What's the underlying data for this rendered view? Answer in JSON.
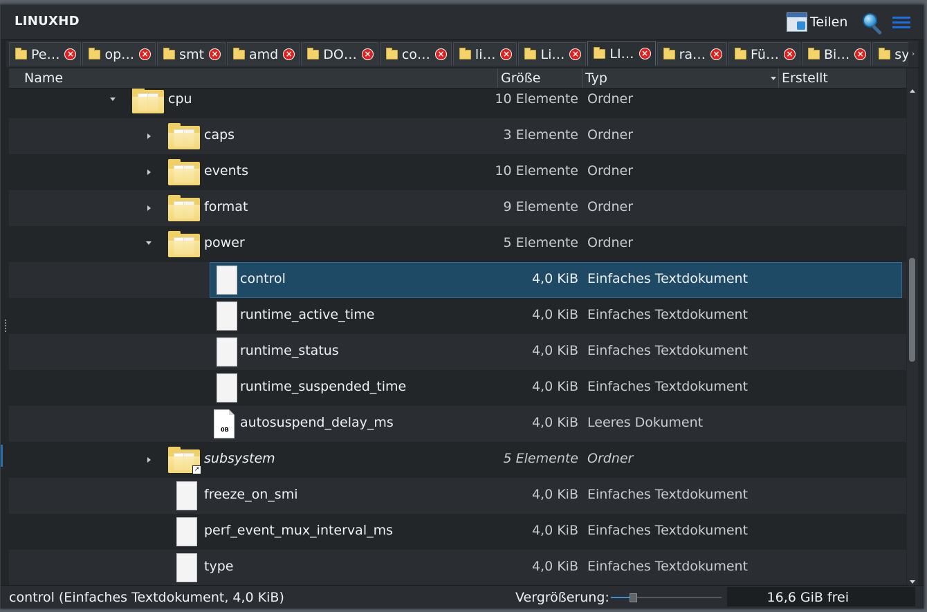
{
  "window": {
    "title": "LINUXHD"
  },
  "toolbar": {
    "share_label": "Teilen"
  },
  "tabs": [
    {
      "label": "Pe…",
      "active": false
    },
    {
      "label": "op…",
      "active": false
    },
    {
      "label": "smt",
      "active": false
    },
    {
      "label": "amd",
      "active": false
    },
    {
      "label": "DO…",
      "active": false
    },
    {
      "label": "co…",
      "active": false
    },
    {
      "label": "li…",
      "active": false
    },
    {
      "label": "Li…",
      "active": false
    },
    {
      "label": "LI…",
      "active": true
    },
    {
      "label": "ra…",
      "active": false
    },
    {
      "label": "Fü…",
      "active": false
    },
    {
      "label": "Bi…",
      "active": false
    },
    {
      "label": "sy",
      "active": false
    }
  ],
  "columns": {
    "name": "Name",
    "size": "Größe",
    "type": "Typ",
    "created": "Erstellt"
  },
  "rows": [
    {
      "name": "cpu",
      "size": "10 Elemente",
      "type": "Ordner",
      "kind": "folder",
      "level": 0,
      "expander": "down"
    },
    {
      "name": "caps",
      "size": "3 Elemente",
      "type": "Ordner",
      "kind": "folder",
      "level": 1,
      "expander": "right"
    },
    {
      "name": "events",
      "size": "10 Elemente",
      "type": "Ordner",
      "kind": "folder",
      "level": 1,
      "expander": "right"
    },
    {
      "name": "format",
      "size": "9 Elemente",
      "type": "Ordner",
      "kind": "folder",
      "level": 1,
      "expander": "right"
    },
    {
      "name": "power",
      "size": "5 Elemente",
      "type": "Ordner",
      "kind": "folder",
      "level": 1,
      "expander": "down"
    },
    {
      "name": "control",
      "size": "4,0 KiB",
      "type": "Einfaches Textdokument",
      "kind": "text",
      "level": 2,
      "selected": true
    },
    {
      "name": "runtime_active_time",
      "size": "4,0 KiB",
      "type": "Einfaches Textdokument",
      "kind": "text",
      "level": 2
    },
    {
      "name": "runtime_status",
      "size": "4,0 KiB",
      "type": "Einfaches Textdokument",
      "kind": "text",
      "level": 2
    },
    {
      "name": "runtime_suspended_time",
      "size": "4,0 KiB",
      "type": "Einfaches Textdokument",
      "kind": "text",
      "level": 2
    },
    {
      "name": "autosuspend_delay_ms",
      "size": "4,0 KiB",
      "type": "Leeres Dokument",
      "kind": "empty",
      "level": 2,
      "icon_label": "0B"
    },
    {
      "name": "subsystem",
      "size": "5 Elemente",
      "type": "Ordner",
      "kind": "folder-link",
      "level": 1,
      "expander": "right",
      "italic": true
    },
    {
      "name": "freeze_on_smi",
      "size": "4,0 KiB",
      "type": "Einfaches Textdokument",
      "kind": "text",
      "level": 1
    },
    {
      "name": "perf_event_mux_interval_ms",
      "size": "4,0 KiB",
      "type": "Einfaches Textdokument",
      "kind": "text",
      "level": 1
    },
    {
      "name": "type",
      "size": "4,0 KiB",
      "type": "Einfaches Textdokument",
      "kind": "text",
      "level": 1
    }
  ],
  "status": {
    "selection": "control (Einfaches Textdokument, 4,0 KiB)",
    "zoom_label": "Vergrößerung:",
    "zoom_level": 0.2,
    "free_space": "16,6 GiB frei"
  },
  "icons": {
    "share": "share-icon",
    "search": "search-icon",
    "menu": "hamburger-menu-icon",
    "tab_close": "close-icon",
    "folder": "folder-icon",
    "text": "text-document-icon",
    "empty": "empty-document-icon",
    "link": "symlink-icon"
  },
  "colors": {
    "selection": "#1f4a66",
    "accent": "#1c6fe0",
    "tab_close": "#e0201f",
    "folder": "#f0cf63"
  }
}
